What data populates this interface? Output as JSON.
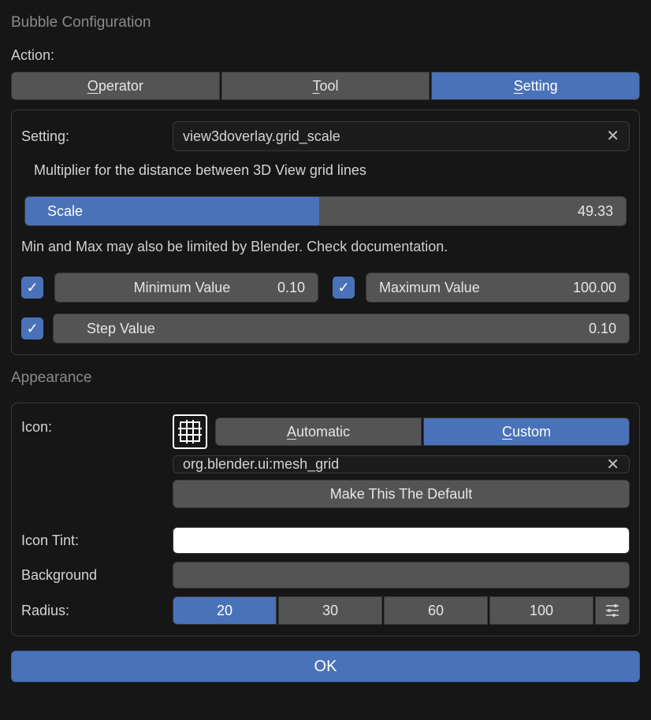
{
  "title": "Bubble Configuration",
  "action": {
    "label": "Action:",
    "tabs": [
      "Operator",
      "Tool",
      "Setting"
    ],
    "active": 2
  },
  "setting": {
    "label": "Setting:",
    "value": "view3doverlay.grid_scale",
    "description": "Multiplier for the distance between 3D View grid lines",
    "scale_label": "Scale",
    "scale_value": "49.33",
    "scale_fill_pct": 49,
    "note": "Min and Max may also be limited by Blender. Check documentation.",
    "min": {
      "enabled": true,
      "label": "Minimum Value",
      "value": "0.10"
    },
    "max": {
      "enabled": true,
      "label": "Maximum Value",
      "value": "100.00"
    },
    "step": {
      "enabled": true,
      "label": "Step Value",
      "value": "0.10"
    }
  },
  "appearance": {
    "title": "Appearance",
    "icon_label": "Icon:",
    "icon_mode_tabs": [
      "Automatic",
      "Custom"
    ],
    "icon_mode_active": 1,
    "icon_path": "org.blender.ui:mesh_grid",
    "make_default_label": "Make This The Default",
    "tint_label": "Icon Tint:",
    "tint_color": "#ffffff",
    "bg_label": "Background",
    "bg_color": "#545454",
    "radius_label": "Radius:",
    "radius_options": [
      "20",
      "30",
      "60",
      "100"
    ],
    "radius_active": 0
  },
  "ok_label": "OK"
}
